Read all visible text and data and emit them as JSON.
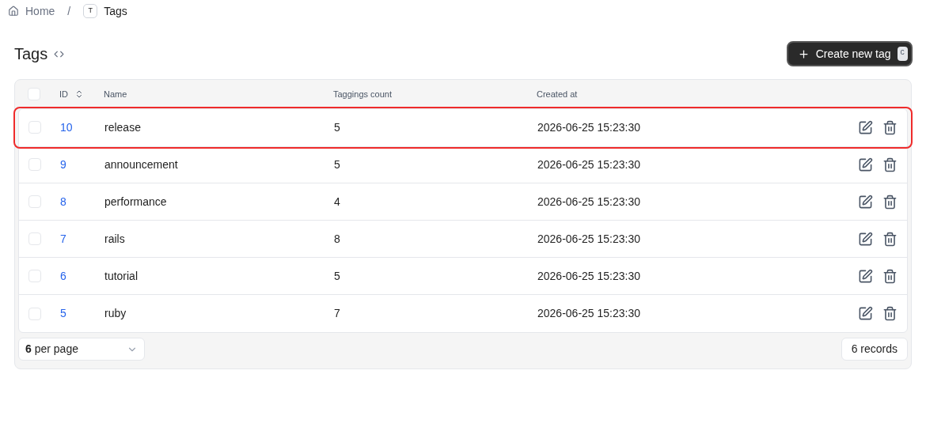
{
  "breadcrumb": {
    "home": "Home",
    "separator": "/",
    "badge": "T",
    "current": "Tags"
  },
  "header": {
    "title": "Tags",
    "create_button": {
      "label": "Create new tag",
      "shortcut": "C"
    }
  },
  "table": {
    "columns": [
      "ID",
      "Name",
      "Taggings count",
      "Created at"
    ],
    "rows": [
      {
        "id": "10",
        "name": "release",
        "count": "5",
        "created": "2026-06-25 15:23:30",
        "checked": false,
        "highlighted": true
      },
      {
        "id": "9",
        "name": "announcement",
        "count": "5",
        "created": "2026-06-25 15:23:30",
        "checked": false,
        "highlighted": false
      },
      {
        "id": "8",
        "name": "performance",
        "count": "4",
        "created": "2026-06-25 15:23:30",
        "checked": false,
        "highlighted": false
      },
      {
        "id": "7",
        "name": "rails",
        "count": "8",
        "created": "2026-06-25 15:23:30",
        "checked": false,
        "highlighted": false
      },
      {
        "id": "6",
        "name": "tutorial",
        "count": "5",
        "created": "2026-06-25 15:23:30",
        "checked": false,
        "highlighted": false
      },
      {
        "id": "5",
        "name": "ruby",
        "count": "7",
        "created": "2026-06-25 15:23:30",
        "checked": false,
        "highlighted": false
      }
    ],
    "select_all_checked": false,
    "per_page": "**6** per page",
    "records": "6 records"
  }
}
